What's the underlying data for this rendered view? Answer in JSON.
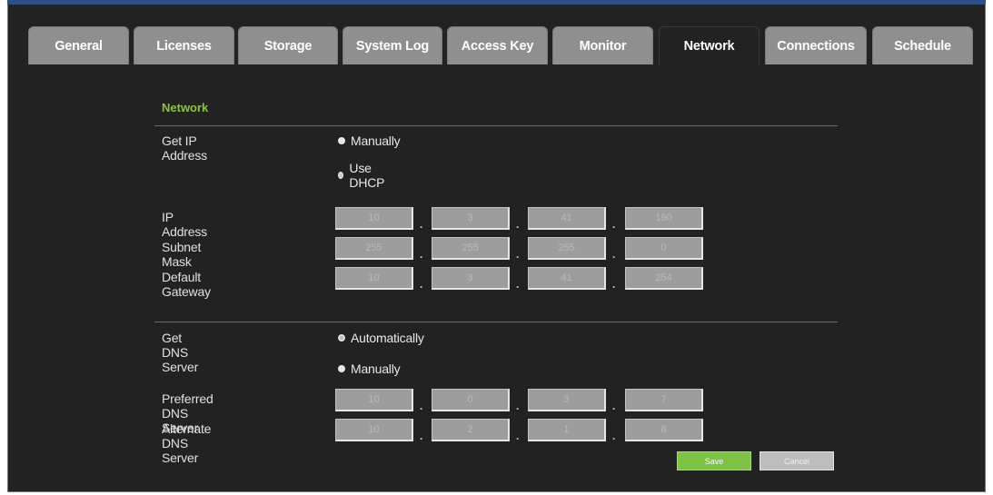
{
  "tabs": [
    {
      "label": "General"
    },
    {
      "label": "Licenses"
    },
    {
      "label": "Storage"
    },
    {
      "label": "System Log"
    },
    {
      "label": "Access Key"
    },
    {
      "label": "Monitor"
    },
    {
      "label": "Network"
    },
    {
      "label": "Connections"
    },
    {
      "label": "Schedule"
    }
  ],
  "active_tab": "Network",
  "section_title": "Network",
  "get_ip": {
    "label": "Get IP Address",
    "options": [
      {
        "label": "Manually",
        "selected": true
      },
      {
        "label": "Use DHCP",
        "selected": false
      }
    ]
  },
  "ip_address": {
    "label": "IP Address",
    "octets": [
      "10",
      "3",
      "41",
      "190"
    ]
  },
  "subnet_mask": {
    "label": "Subnet Mask",
    "octets": [
      "255",
      "255",
      "255",
      "0"
    ]
  },
  "default_gateway": {
    "label": "Default Gateway",
    "octets": [
      "10",
      "3",
      "41",
      "254"
    ]
  },
  "get_dns": {
    "label": "Get DNS Server",
    "options": [
      {
        "label": "Automatically",
        "selected": false
      },
      {
        "label": "Manually",
        "selected": true
      }
    ]
  },
  "preferred_dns": {
    "label": "Preferred DNS Server",
    "octets": [
      "10",
      "0",
      "3",
      "7"
    ]
  },
  "alternate_dns": {
    "label": "Alternate DNS Server",
    "octets": [
      "10",
      "2",
      "1",
      "8"
    ]
  },
  "buttons": {
    "save": "Save",
    "cancel": "Cancel"
  },
  "colors": {
    "accent": "#8cc63f",
    "background": "#222222",
    "tab": "#8f8f8f",
    "save": "#7dc243"
  }
}
